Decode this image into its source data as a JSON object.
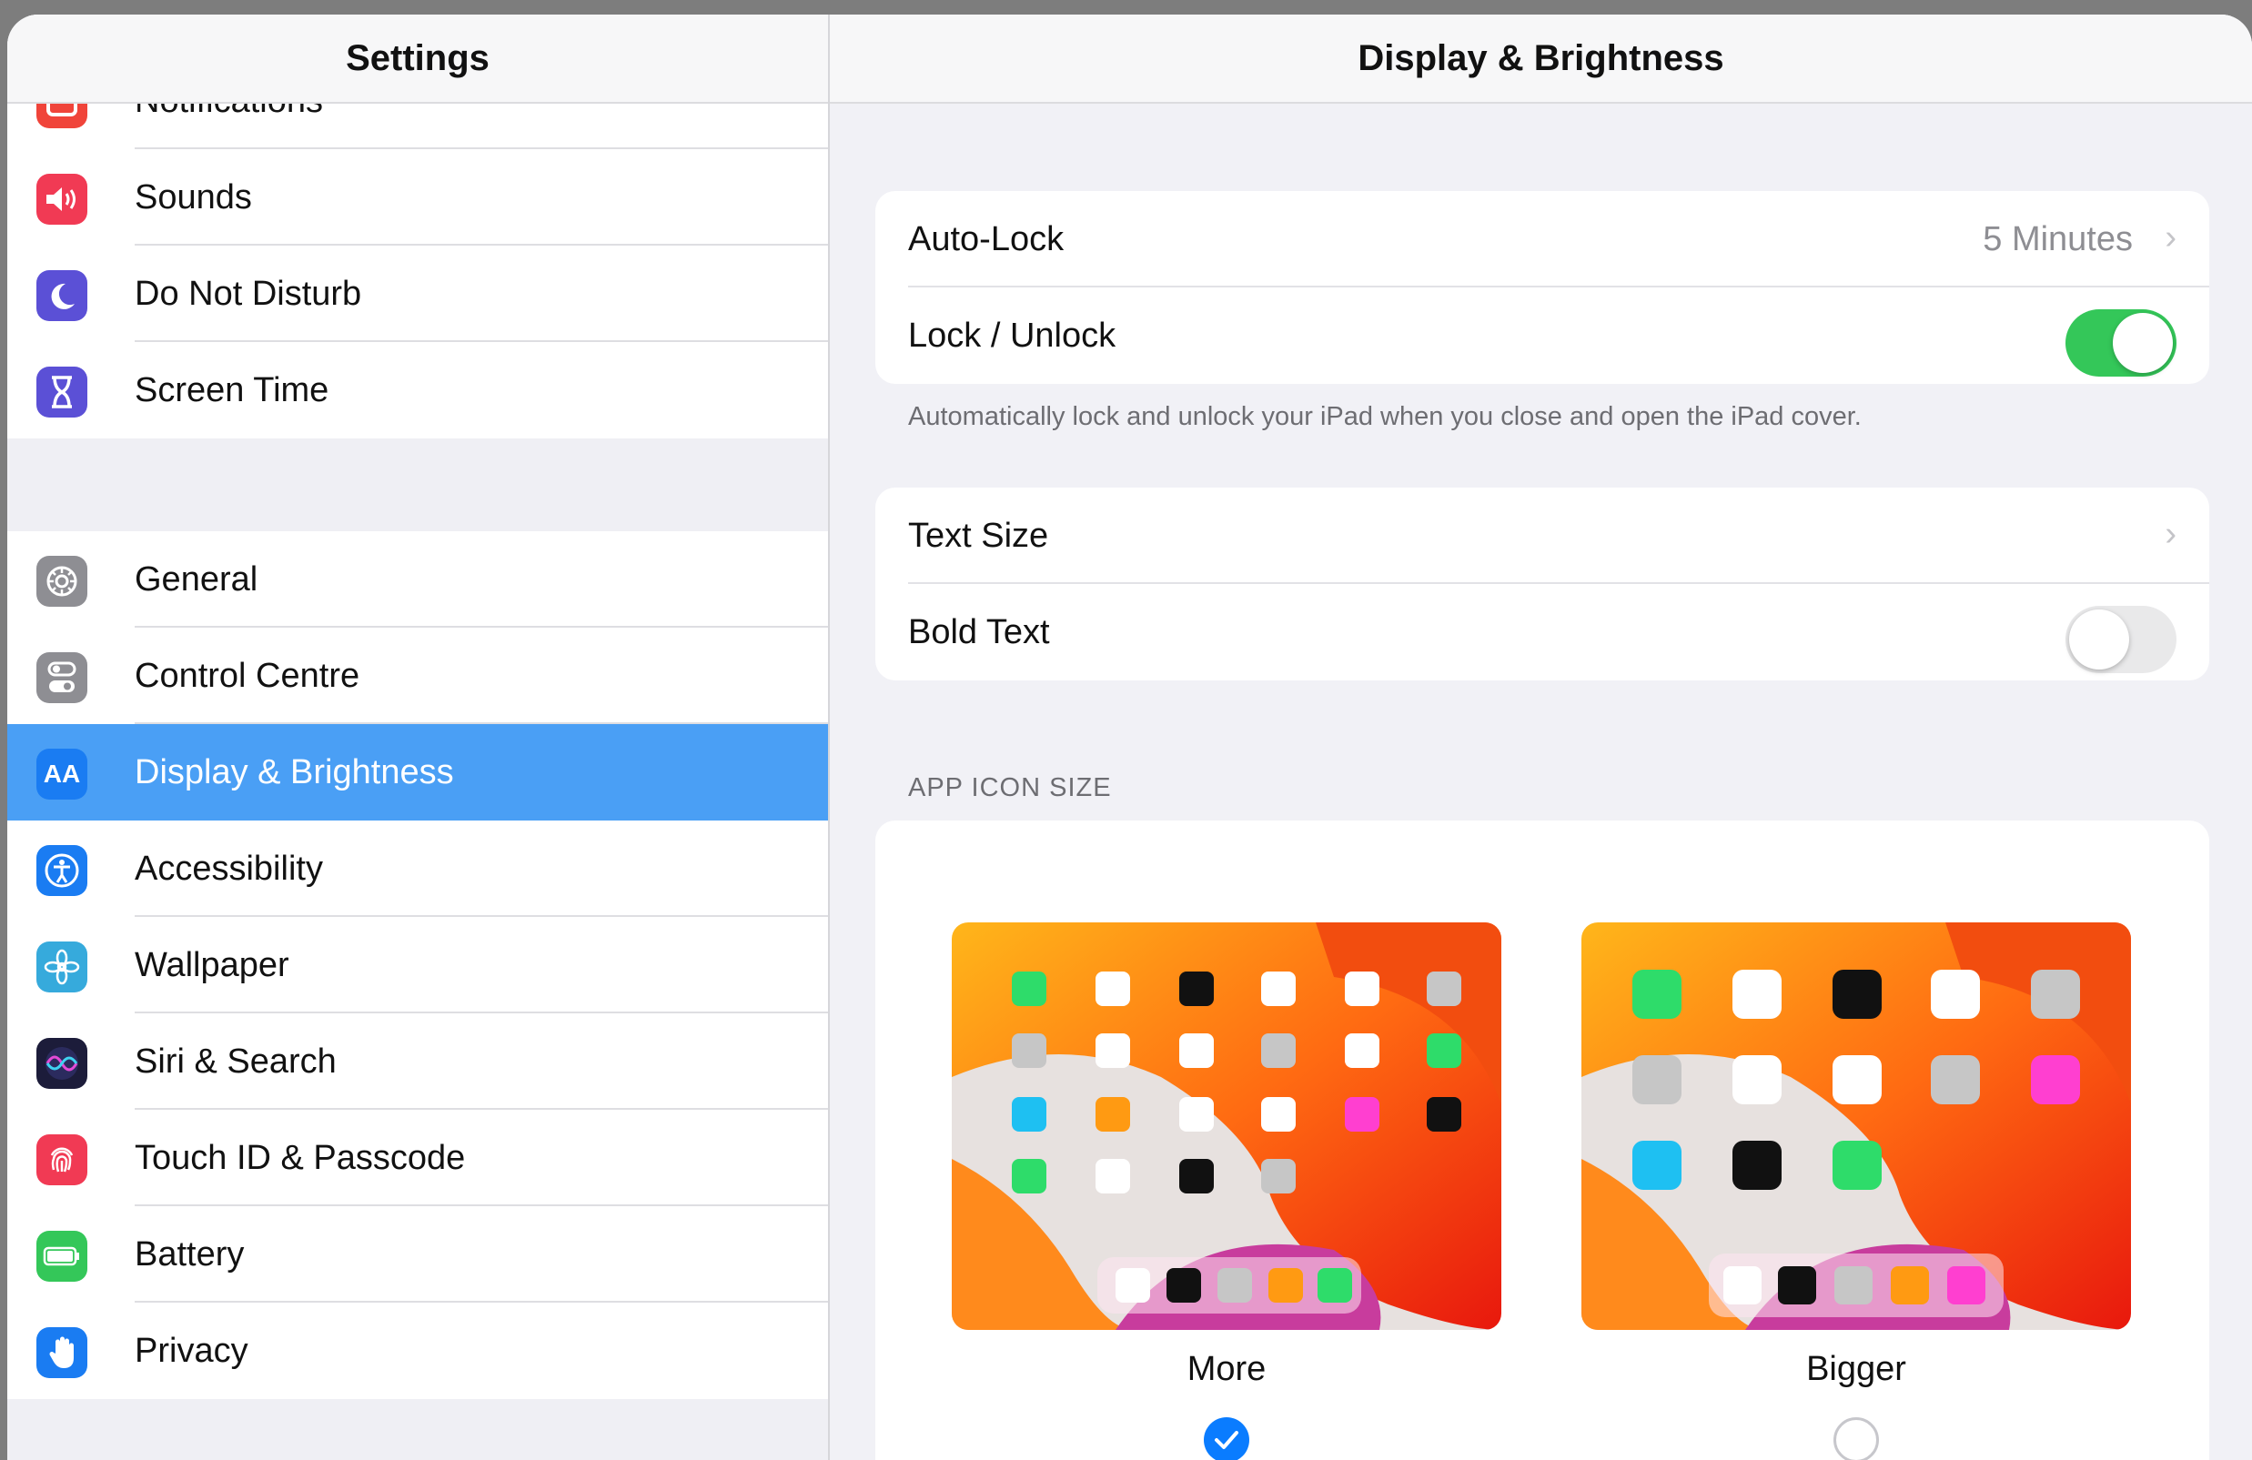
{
  "sidebar": {
    "title": "Settings",
    "group1": [
      {
        "label": "Notifications",
        "icon": "notifications-icon",
        "color": "#f0443a"
      },
      {
        "label": "Sounds",
        "icon": "speaker-icon",
        "color": "#f13a54"
      },
      {
        "label": "Do Not Disturb",
        "icon": "moon-icon",
        "color": "#5b50d6"
      },
      {
        "label": "Screen Time",
        "icon": "hourglass-icon",
        "color": "#5b50d6"
      }
    ],
    "group2": [
      {
        "label": "General",
        "icon": "gear-icon",
        "color": "#8e8e93"
      },
      {
        "label": "Control Centre",
        "icon": "switches-icon",
        "color": "#8e8e93"
      },
      {
        "label": "Display & Brightness",
        "icon": "text-size-icon",
        "color": "#1a7cf2",
        "selected": true
      },
      {
        "label": "Accessibility",
        "icon": "accessibility-icon",
        "color": "#1a7cf2"
      },
      {
        "label": "Wallpaper",
        "icon": "flower-icon",
        "color": "#36aadc"
      },
      {
        "label": "Siri & Search",
        "icon": "siri-icon",
        "color": "#1c1c3a"
      },
      {
        "label": "Touch ID & Passcode",
        "icon": "fingerprint-icon",
        "color": "#f13a54"
      },
      {
        "label": "Battery",
        "icon": "battery-icon",
        "color": "#34c759"
      },
      {
        "label": "Privacy",
        "icon": "hand-icon",
        "color": "#1a7cf2"
      }
    ]
  },
  "main": {
    "title": "Display & Brightness",
    "auto_lock": {
      "label": "Auto-Lock",
      "value": "5 Minutes"
    },
    "lock_unlock": {
      "label": "Lock / Unlock",
      "on": true
    },
    "lock_footnote": "Automatically lock and unlock your iPad when you close and open the iPad cover.",
    "text_size": {
      "label": "Text Size"
    },
    "bold_text": {
      "label": "Bold Text",
      "on": false
    },
    "app_icon_section": "APP ICON SIZE",
    "options": [
      {
        "label": "More",
        "selected": true
      },
      {
        "label": "Bigger",
        "selected": false
      }
    ]
  },
  "colors": {
    "selected_row": "#4a9ff5",
    "toggle_on": "#34c759",
    "accent": "#0a7cff"
  }
}
